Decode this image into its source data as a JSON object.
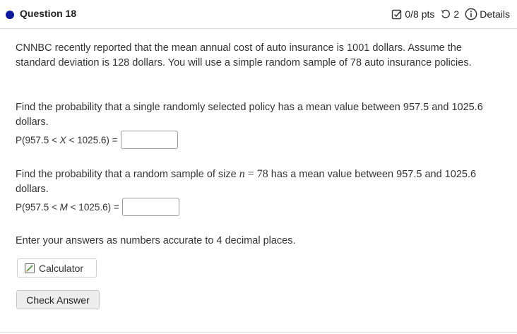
{
  "question": {
    "title": "Question 18",
    "points": "0/8 pts",
    "attempts": "2",
    "details_label": "Details",
    "accent_color": "#0b1a9c"
  },
  "content": {
    "intro": "CNNBC recently reported that the mean annual cost of auto insurance is 1001 dollars. Assume the standard deviation is 128 dollars. You will use a simple random sample of 78 auto insurance policies.",
    "part1_text": "Find the probability that a single randomly selected policy has a mean value between 957.5 and 1025.6 dollars.",
    "part1_lhs_prefix": "P(957.5 < ",
    "part1_var": "X",
    "part1_lhs_suffix": " < 1025.6) =",
    "part1_value": "",
    "part2_text_before": "Find the probability that a random sample of size ",
    "part2_n_symbol": "n",
    "part2_eq": " = ",
    "part2_n_value": "78",
    "part2_text_after": " has a mean value between 957.5 and 1025.6 dollars.",
    "part2_lhs_prefix": "P(957.5 < ",
    "part2_var": "M",
    "part2_lhs_suffix": " < 1025.6) =",
    "part2_value": "",
    "instructions": "Enter your answers as numbers accurate to 4 decimal places."
  },
  "buttons": {
    "calculator_label": "Calculator",
    "check_answer_label": "Check Answer"
  },
  "icons": {
    "points": "checkbox-icon",
    "attempts": "retry-icon",
    "details": "info-icon",
    "calculator": "calculator-icon"
  }
}
